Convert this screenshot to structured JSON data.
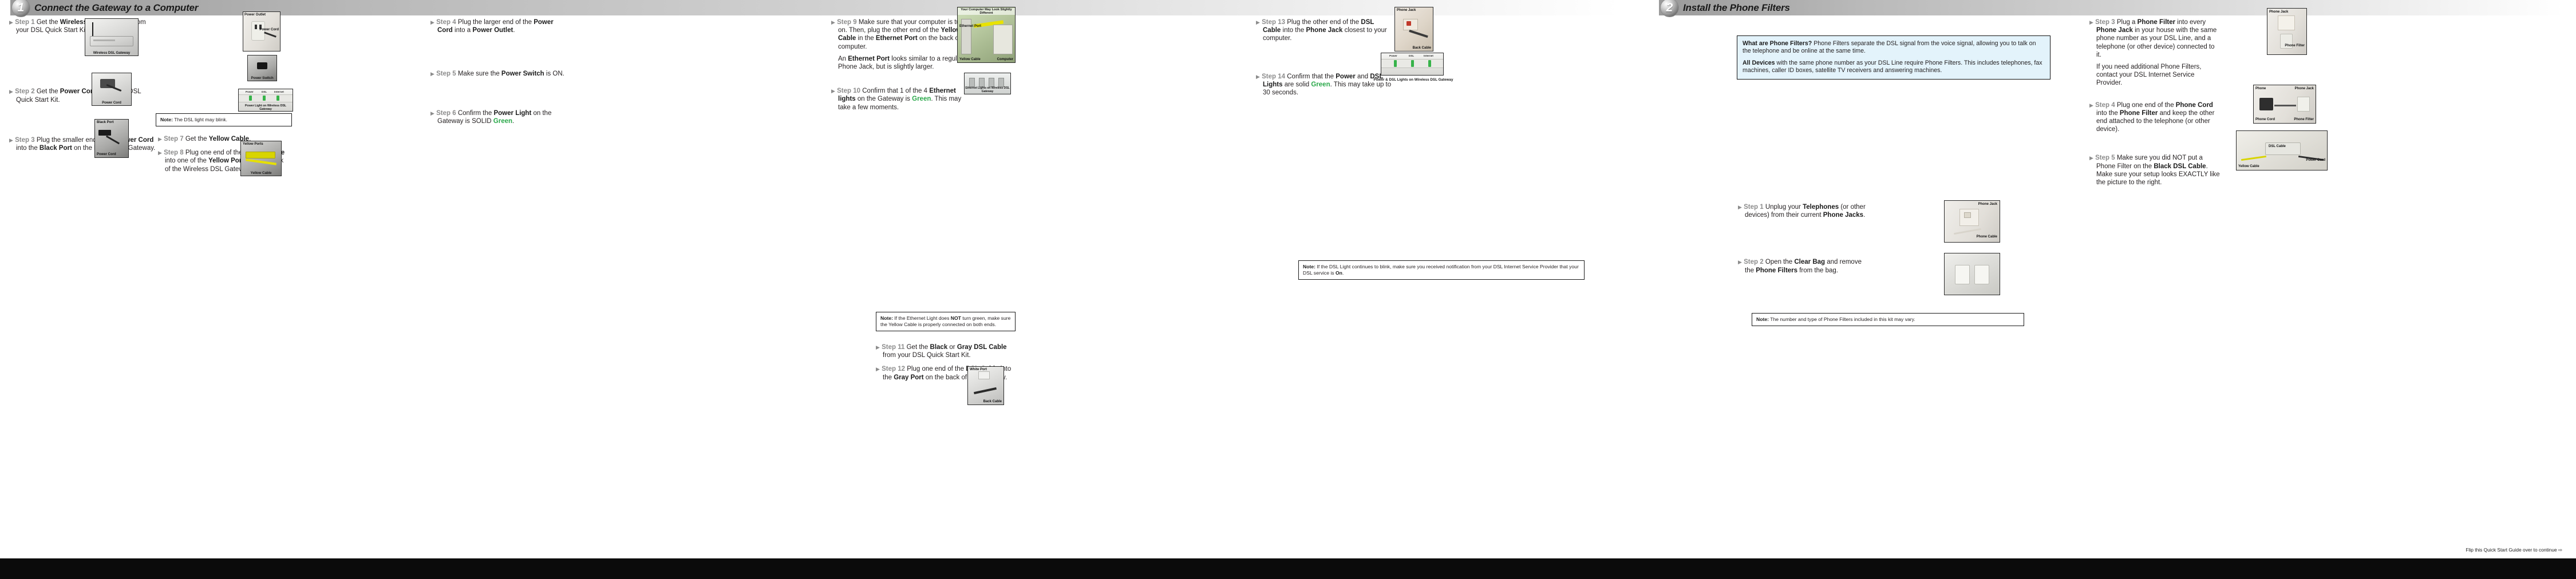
{
  "sections": [
    {
      "number": "1",
      "title": "Connect the Gateway to a Computer"
    },
    {
      "number": "2",
      "title": "Install the Phone Filters"
    }
  ],
  "gateway": {
    "col1": {
      "step1": {
        "label": "Step 1",
        "text_html": "Get the <b>Wireless DSL Gateway</b> from your DSL Quick Start Kit.",
        "figure_caption": "Wireless DSL Gateway"
      },
      "step2": {
        "label": "Step 2",
        "text_html": "Get the <b>Power Cord</b> from your DSL Quick Start Kit.",
        "figure_caption": "Power Cord"
      },
      "step3": {
        "label": "Step 3",
        "text_html": "Plug the smaller end of the <b>Power Cord</b> into the <b>Black Port</b> on the back of the Gateway.",
        "figure_caption_top": "Black Port",
        "figure_caption_bottom": "Power Cord"
      }
    },
    "col2": {
      "step4": {
        "label": "Step 4",
        "text_html": "Plug the larger end of the <b>Power Cord</b> into a <b>Power Outlet</b>.",
        "figure_caption_left": "Power Outlet",
        "figure_caption_right": "Power Cord"
      },
      "step5": {
        "label": "Step 5",
        "text_html": "Make sure the <b>Power Switch</b> is ON.",
        "figure_caption": "Power Switch"
      },
      "step6": {
        "label": "Step 6",
        "text_html": "Confirm the <b>Power Light</b> on the Gateway is SOLID <span class=\"green\">Green</span>.",
        "figure_caption": "Power Light on Wireless DSL Gateway",
        "figure_labels": [
          "Power",
          "DSL",
          "Internet"
        ]
      },
      "note6": {
        "prefix": "Note:",
        "text": "The DSL light may blink."
      },
      "step7": {
        "label": "Step 7",
        "text_html": "Get the <b>Yellow Cable</b>."
      },
      "step8": {
        "label": "Step 8",
        "text_html": "Plug one end of the <b>Yellow Cable</b> into one of the <b>Yellow Ports</b> on the back of the Wireless DSL Gateway.",
        "figure_caption": "Yellow Cable",
        "figure_caption_top": "Yellow Ports"
      }
    },
    "col3": {
      "step9": {
        "label": "Step 9",
        "text_html": "Make sure that your computer is turned on. Then, plug the other end of the <b>Yellow Cable</b> in the <b>Ethernet Port</b> on the back of the computer.",
        "para": "An <b>Ethernet Port</b> looks similar to a regular Phone Jack, but is slightly larger.",
        "figure_top_label": "Your Computer May Look Slightly Different",
        "figure_caption_ethernet": "Ethernet Port",
        "figure_caption_yellow": "Yellow Cable",
        "figure_caption_computer": "Computer"
      },
      "step10": {
        "label": "Step 10",
        "text_html": "Confirm that 1 of the 4 <b>Ethernet lights</b> on the Gateway is <span class=\"green\">Green</span>. This may take a few moments.",
        "figure_caption": "Ethernet Lights on Wireless DSL Gateway"
      },
      "note10": {
        "prefix": "Note:",
        "text_html": "If the Ethernet Light does <b>NOT</b> turn green, make sure the Yellow Cable is properly connected on both ends."
      },
      "step11": {
        "label": "Step 11",
        "text_html": "Get the <b>Black</b> or <b>Gray DSL Cable</b> from your DSL Quick Start Kit."
      },
      "step12": {
        "label": "Step 12",
        "text_html": "Plug one end of the <b>DSL Cable</b> into the <b>Gray Port</b> on the back of the Gateway.",
        "figure_caption_top": "White Port",
        "figure_caption_bottom": "Back Cable"
      }
    },
    "col4": {
      "step13": {
        "label": "Step 13",
        "text_html": "Plug the other end of the <b>DSL Cable</b> into the <b>Phone Jack</b> closest to your computer.",
        "figure_caption_top": "Phone Jack",
        "figure_caption_bottom": "Back Cable"
      },
      "step14": {
        "label": "Step 14",
        "text_html": "Confirm that the <b>Power</b> and <b>DSL Lights</b> are solid <span class=\"green\">Green</span>. This may take up to 30 seconds.",
        "figure_caption": "Power & DSL Lights on Wireless DSL Gateway",
        "figure_labels": [
          "Power",
          "DSL",
          "Internet"
        ]
      },
      "note14": {
        "prefix": "Note:",
        "text_html": "If the DSL Light continues to blink, make sure you received notification from your DSL Internet Service Provider that your DSL service is <b>On</b>."
      }
    }
  },
  "filters": {
    "infobox": {
      "q_bold": "What are Phone Filters?",
      "q_rest": " Phone Filters separate the DSL signal from the voice signal, allowing you to talk on the telephone and be online at the same time.",
      "p2_bold": "All Devices",
      "p2_rest": " with the same phone number as your DSL Line require Phone Filters. This includes telephones, fax machines, caller ID boxes, satellite TV receivers and answering machines."
    },
    "col1": {
      "step1": {
        "label": "Step 1",
        "text_html": "Unplug your <b>Telephones</b> (or other devices) from their current <b>Phone Jacks</b>.",
        "figure_caption_top": "Phone Jack",
        "figure_caption_bottom": "Phone Cable"
      },
      "step2": {
        "label": "Step 2",
        "text_html": "Open the <b>Clear Bag</b> and remove the <b>Phone Filters</b> from the bag."
      },
      "note2": {
        "prefix": "Note:",
        "text": "The number and type of Phone Filters included in this kit may vary."
      }
    },
    "col2": {
      "step3": {
        "label": "Step 3",
        "text_html": "Plug a <b>Phone Filter</b> into every <b>Phone Jack</b> in your house with the same phone number as your DSL Line, and a telephone (or other device) connected to it.",
        "para": "If you need additional Phone Filters, contact your DSL Internet Service Provider.",
        "figure_caption_top": "Phone Jack",
        "figure_caption_bottom": "Phone Filter"
      },
      "step4": {
        "label": "Step 4",
        "text_html": "Plug one end of the <b>Phone Cord</b> into the <b>Phone Filter</b> and keep the other end attached to the telephone (or other device).",
        "figure_labels": [
          "Phone",
          "Phone Jack",
          "Phone Cord",
          "Phone Filter"
        ]
      },
      "step5": {
        "label": "Step 5",
        "text_html": "Make sure you did NOT put a Phone Filter on the <b>Black DSL Cable</b>. Make sure your setup looks EXACTLY like the picture to the right.",
        "figure_labels": [
          "DSL Cable",
          "Power Cord",
          "Yellow Cable"
        ]
      }
    }
  },
  "footer": {
    "flip_text": "Flip this Quick Start Guide over to continue ⇨"
  },
  "colors": {
    "green": "#2aa84a",
    "step_label": "#8c8c8c",
    "info_bg": "#e3f3fb",
    "footer_bar": "#0b0b0b"
  }
}
